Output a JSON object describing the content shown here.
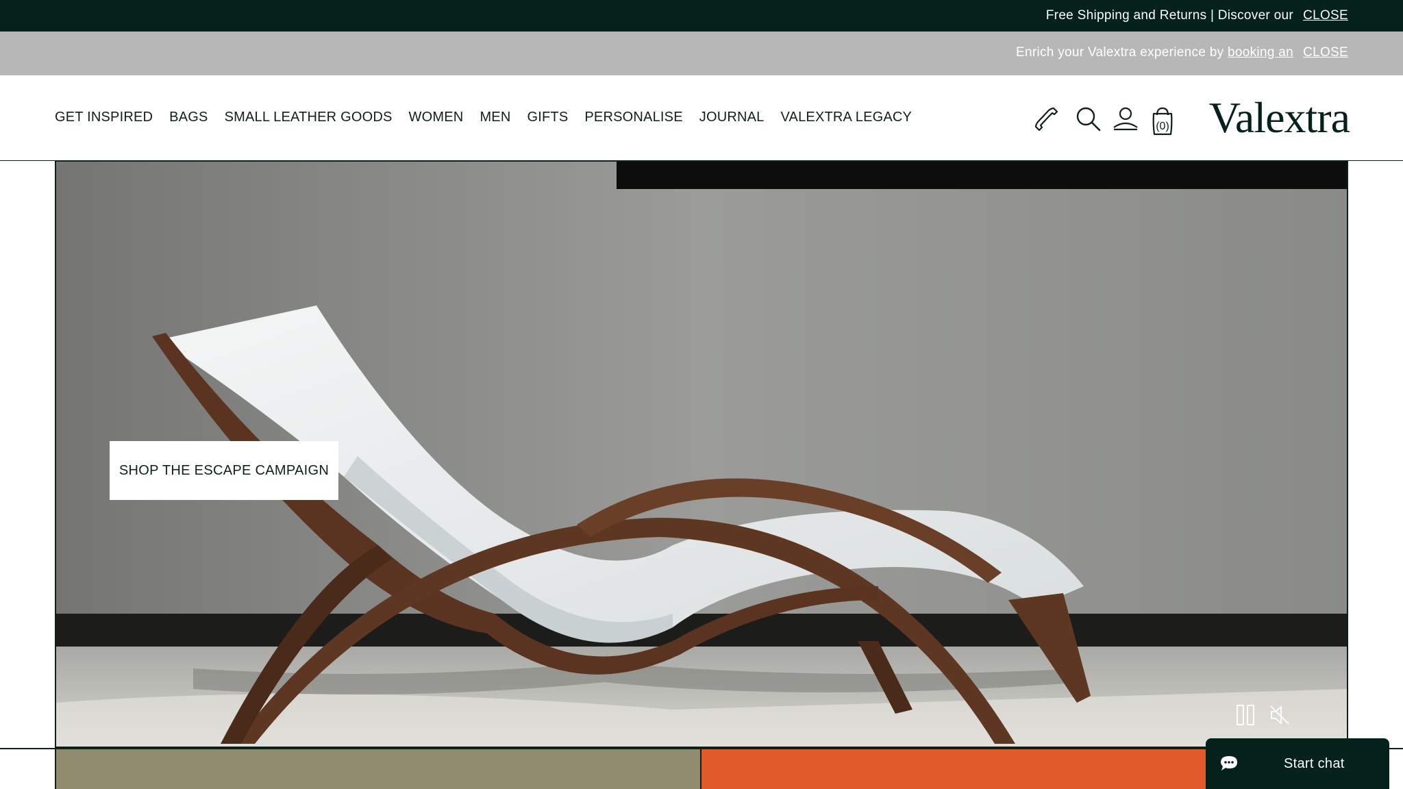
{
  "announcement": {
    "text": "Free Shipping and Returns | Discover our",
    "close_label": "CLOSE"
  },
  "booking_bar": {
    "text": "Enrich your Valextra experience by ",
    "link_text": "booking an",
    "close_label": "CLOSE"
  },
  "nav": {
    "items": [
      {
        "label": "GET INSPIRED"
      },
      {
        "label": "BAGS"
      },
      {
        "label": "SMALL LEATHER GOODS"
      },
      {
        "label": "WOMEN"
      },
      {
        "label": "MEN"
      },
      {
        "label": "GIFTS"
      },
      {
        "label": "PERSONALISE"
      },
      {
        "label": "JOURNAL"
      },
      {
        "label": "VALEXTRA LEGACY"
      }
    ]
  },
  "header_icons": {
    "phone": "phone-icon",
    "search": "search-icon",
    "account": "account-icon",
    "bag": "shopping-bag-icon",
    "bag_count": "(0)"
  },
  "brand": {
    "logo_text": "Valextra"
  },
  "hero": {
    "cta_label": "SHOP THE ESCAPE CAMPAIGN",
    "pause_icon": "pause-icon",
    "mute_icon": "mute-icon"
  },
  "chat": {
    "label": "Start chat",
    "icon": "chat-bubble-icon"
  },
  "colors": {
    "dark_green": "#04211c",
    "grey_bar": "#b7b7b7",
    "orange_tile": "#e05a2a",
    "olive_tile": "#8f8c6f"
  }
}
